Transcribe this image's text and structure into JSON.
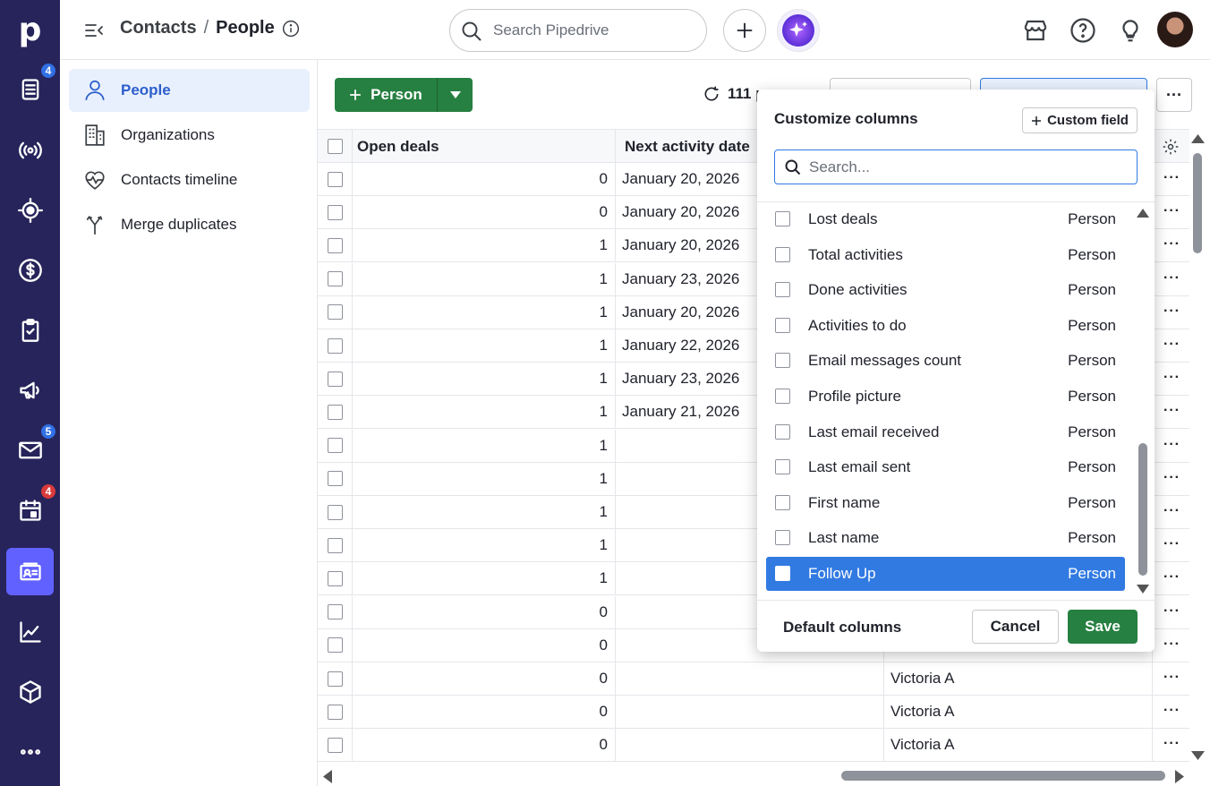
{
  "app": {
    "logo": "p"
  },
  "rail": {
    "items": [
      {
        "icon": "leads-inbox-icon",
        "badge": "4"
      },
      {
        "icon": "broadcast-icon",
        "badge": ""
      },
      {
        "icon": "target-icon",
        "badge": ""
      },
      {
        "icon": "dollar-icon",
        "badge": ""
      },
      {
        "icon": "clipboard-check-icon",
        "badge": ""
      },
      {
        "icon": "megaphone-icon",
        "badge": ""
      },
      {
        "icon": "mail-icon",
        "badge": "5"
      },
      {
        "icon": "calendar-icon",
        "badge": "4"
      },
      {
        "icon": "contacts-card-icon",
        "badge": ""
      },
      {
        "icon": "chart-icon",
        "badge": ""
      },
      {
        "icon": "box-icon",
        "badge": ""
      },
      {
        "icon": "more-dots-icon",
        "badge": ""
      }
    ]
  },
  "header": {
    "breadcrumb_parent": "Contacts",
    "breadcrumb_sep": "/",
    "breadcrumb_current": "People",
    "search_placeholder": "Search Pipedrive"
  },
  "subnav": {
    "items": [
      {
        "label": "People"
      },
      {
        "label": "Organizations"
      },
      {
        "label": "Contacts timeline"
      },
      {
        "label": "Merge duplicates"
      }
    ]
  },
  "toolbar": {
    "add_label": "Person",
    "count_label": "111 p"
  },
  "table": {
    "headers": [
      "Open deals",
      "Next activity date"
    ],
    "rows": [
      {
        "deals": "0",
        "date": "January 20, 2026",
        "owner": ""
      },
      {
        "deals": "0",
        "date": "January 20, 2026",
        "owner": ""
      },
      {
        "deals": "1",
        "date": "January 20, 2026",
        "owner": ""
      },
      {
        "deals": "1",
        "date": "January 23, 2026",
        "owner": ""
      },
      {
        "deals": "1",
        "date": "January 20, 2026",
        "owner": ""
      },
      {
        "deals": "1",
        "date": "January 22, 2026",
        "owner": ""
      },
      {
        "deals": "1",
        "date": "January 23, 2026",
        "owner": ""
      },
      {
        "deals": "1",
        "date": "January 21, 2026",
        "owner": ""
      },
      {
        "deals": "1",
        "date": "",
        "owner": ""
      },
      {
        "deals": "1",
        "date": "",
        "owner": ""
      },
      {
        "deals": "1",
        "date": "",
        "owner": ""
      },
      {
        "deals": "1",
        "date": "",
        "owner": ""
      },
      {
        "deals": "1",
        "date": "",
        "owner": ""
      },
      {
        "deals": "0",
        "date": "",
        "owner": ""
      },
      {
        "deals": "0",
        "date": "",
        "owner": ""
      },
      {
        "deals": "0",
        "date": "",
        "owner": "Victoria A"
      },
      {
        "deals": "0",
        "date": "",
        "owner": "Victoria A"
      },
      {
        "deals": "0",
        "date": "",
        "owner": "Victoria A"
      }
    ]
  },
  "panel": {
    "title": "Customize columns",
    "custom_field_label": "Custom field",
    "search_placeholder": "Search...",
    "items": [
      {
        "name": "Lost deals",
        "source": "Person"
      },
      {
        "name": "Total activities",
        "source": "Person"
      },
      {
        "name": "Done activities",
        "source": "Person"
      },
      {
        "name": "Activities to do",
        "source": "Person"
      },
      {
        "name": "Email messages count",
        "source": "Person"
      },
      {
        "name": "Profile picture",
        "source": "Person"
      },
      {
        "name": "Last email received",
        "source": "Person"
      },
      {
        "name": "Last email sent",
        "source": "Person"
      },
      {
        "name": "First name",
        "source": "Person"
      },
      {
        "name": "Last name",
        "source": "Person"
      },
      {
        "name": "Follow Up",
        "source": "Person"
      }
    ],
    "default_columns_label": "Default columns",
    "cancel_label": "Cancel",
    "save_label": "Save"
  },
  "colors": {
    "accent": "#268041",
    "rail": "#26245a",
    "selected": "#317ae2",
    "rail_active": "#6161ff"
  }
}
